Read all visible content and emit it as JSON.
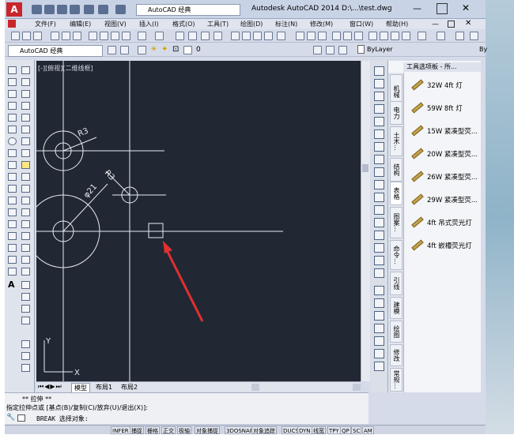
{
  "title": {
    "app": "Autodesk AutoCAD 2014",
    "file": "D:\\...\\test.dwg"
  },
  "workspace": "AutoCAD 经典",
  "workspace2": "AutoCAD 经典",
  "menu": [
    "文件(F)",
    "编辑(E)",
    "视图(V)",
    "插入(I)",
    "格式(O)",
    "工具(T)",
    "绘图(D)",
    "标注(N)",
    "修改(M)",
    "窗口(W)",
    "帮助(H)"
  ],
  "layer": {
    "value": "0",
    "bylayer": "ByLayer"
  },
  "viewport_label": "[-][俯视][二维线框]",
  "dims": {
    "r3a": "R3",
    "r3b": "R3",
    "d21": "φ21"
  },
  "ucs": {
    "x": "X",
    "y": "Y"
  },
  "palette": {
    "title": "工具选项板 - 所...",
    "tabs": [
      "机械",
      "电力",
      "土木...",
      "结构",
      "图案...",
      "表格",
      "命令...",
      "引线",
      "建模",
      "绘图",
      "修改",
      "常规..."
    ],
    "items": [
      "32W 4ft 灯",
      "59W 8ft 灯",
      "15W 紧凑型荧...",
      "20W 紧凑型荧...",
      "26W 紧凑型荧...",
      "29W 紧凑型荧...",
      "4ft 吊式荧光灯",
      "4ft 嵌槽荧光灯"
    ]
  },
  "layout_tabs": [
    "模型",
    "布局1",
    "布局2"
  ],
  "command": {
    "line1": "** 拉伸 **",
    "line2": "指定拉伸点或 [基点(B)/复制(C)/放弃(U)/退出(X)]:",
    "prompt": "BREAK 选择对象:"
  },
  "status": [
    "INFER",
    "捕捉",
    "栅格",
    "正交",
    "极轴",
    "对象捕捉",
    "3DOSNAP",
    "对象追踪",
    "DUCS",
    "DYN",
    "线宽",
    "TPY",
    "QP",
    "SC",
    "AM"
  ],
  "right_fragment": "By"
}
